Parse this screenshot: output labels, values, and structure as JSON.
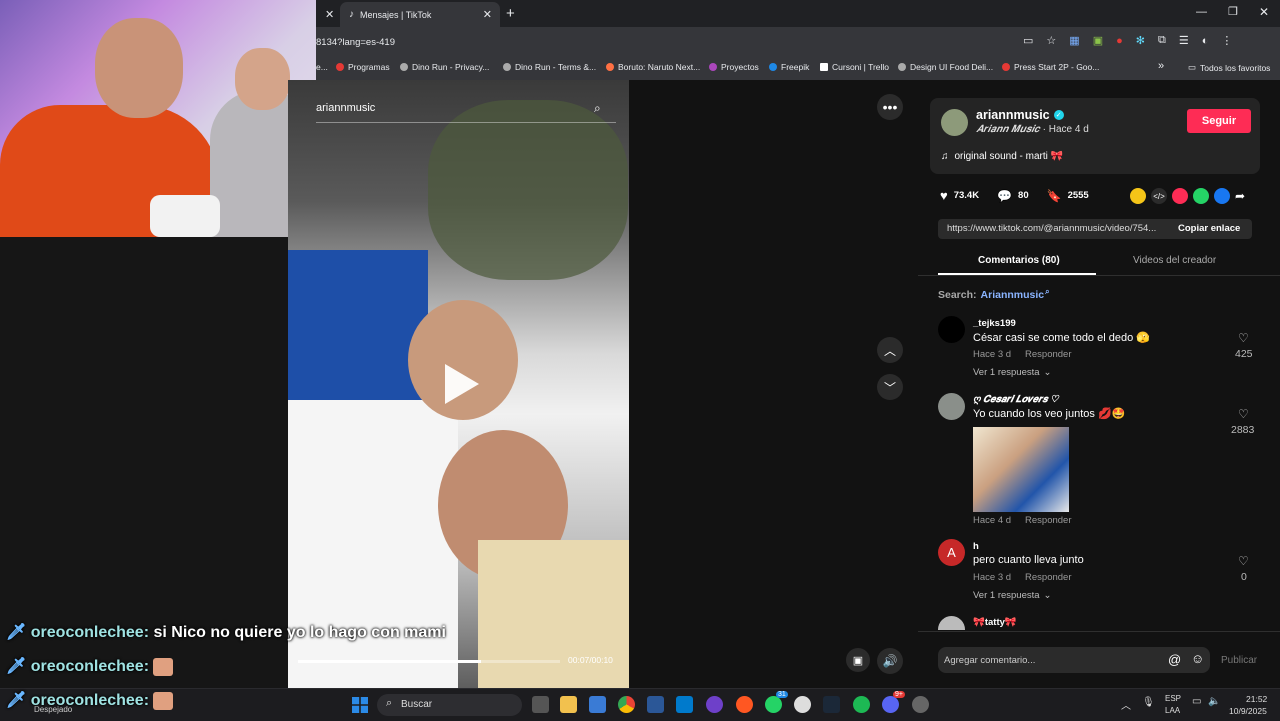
{
  "browser": {
    "tab_title": "Mensajes | TikTok",
    "new_tab": "+",
    "url": "8134?lang=es-419",
    "bookmarks": [
      "e...",
      "Programas",
      "Dino Run - Privacy...",
      "Dino Run - Terms &...",
      "Boruto: Naruto Next...",
      "Proyectos",
      "Freepik",
      "Cursoni | Trello",
      "Design UI Food Deli...",
      "Press Start 2P - Goo..."
    ],
    "bookmarks_more": "»",
    "all_bookmarks": "Todos los favoritos"
  },
  "video": {
    "search_text": "ariannmusic",
    "time": "00:07/00:10",
    "progress": 0.7
  },
  "creator": {
    "username": "ariannmusic",
    "display_name": "𝑨𝒓𝒊𝒂𝒏𝒏 𝑴𝒖𝒔𝒊𝒄",
    "posted": "· Hace 4 d",
    "follow_label": "Seguir",
    "sound": "original sound - marti 🎀"
  },
  "stats": {
    "likes": "73.4K",
    "comments": "80",
    "saves": "2555"
  },
  "link": {
    "url": "https://www.tiktok.com/@ariannmusic/video/754...",
    "copy_label": "Copiar enlace"
  },
  "tabs": {
    "comments": "Comentarios (80)",
    "creator_videos": "Videos del creador"
  },
  "search_suggest": {
    "prefix": "Search:",
    "term": "Ariannmusic"
  },
  "comments": [
    {
      "user": "_tejks199",
      "text": "César casi se come todo el dedo 🫣",
      "time": "Hace 3 d",
      "reply": "Responder",
      "replies": "Ver 1 respuesta",
      "likes": "425"
    },
    {
      "user": "ღ 𝑪𝒆𝒔𝒂𝒓𝒊 𝑳𝒐𝒗𝒆𝒓𝒔 ♡",
      "text": "Yo cuando los veo juntos 💋🤩",
      "time": "Hace 4 d",
      "reply": "Responder",
      "likes": "2883"
    },
    {
      "user": "h",
      "avatar_letter": "A",
      "text": "pero cuanto lleva junto",
      "time": "Hace 3 d",
      "reply": "Responder",
      "replies": "Ver 1 respuesta",
      "likes": "0"
    },
    {
      "user": "🎀tatty🎀"
    }
  ],
  "comment_input": {
    "placeholder": "Agregar comentario...",
    "publish": "Publicar"
  },
  "chat": [
    {
      "user": "oreoconlechee:",
      "message": "si Nico no quiere yo lo hago con mami"
    },
    {
      "user": "oreoconlechee:",
      "message": ""
    },
    {
      "user": "oreoconlechee:",
      "message": ""
    }
  ],
  "taskbar": {
    "weather": "Despejado",
    "search": "Buscar",
    "lang_top": "ESP",
    "lang_bottom": "LAA",
    "time": "21:52",
    "date": "10/9/2025",
    "badge1": "31",
    "badge2": "9+"
  },
  "colors": {
    "accent": "#fe2c55",
    "verified": "#20d5ec"
  }
}
